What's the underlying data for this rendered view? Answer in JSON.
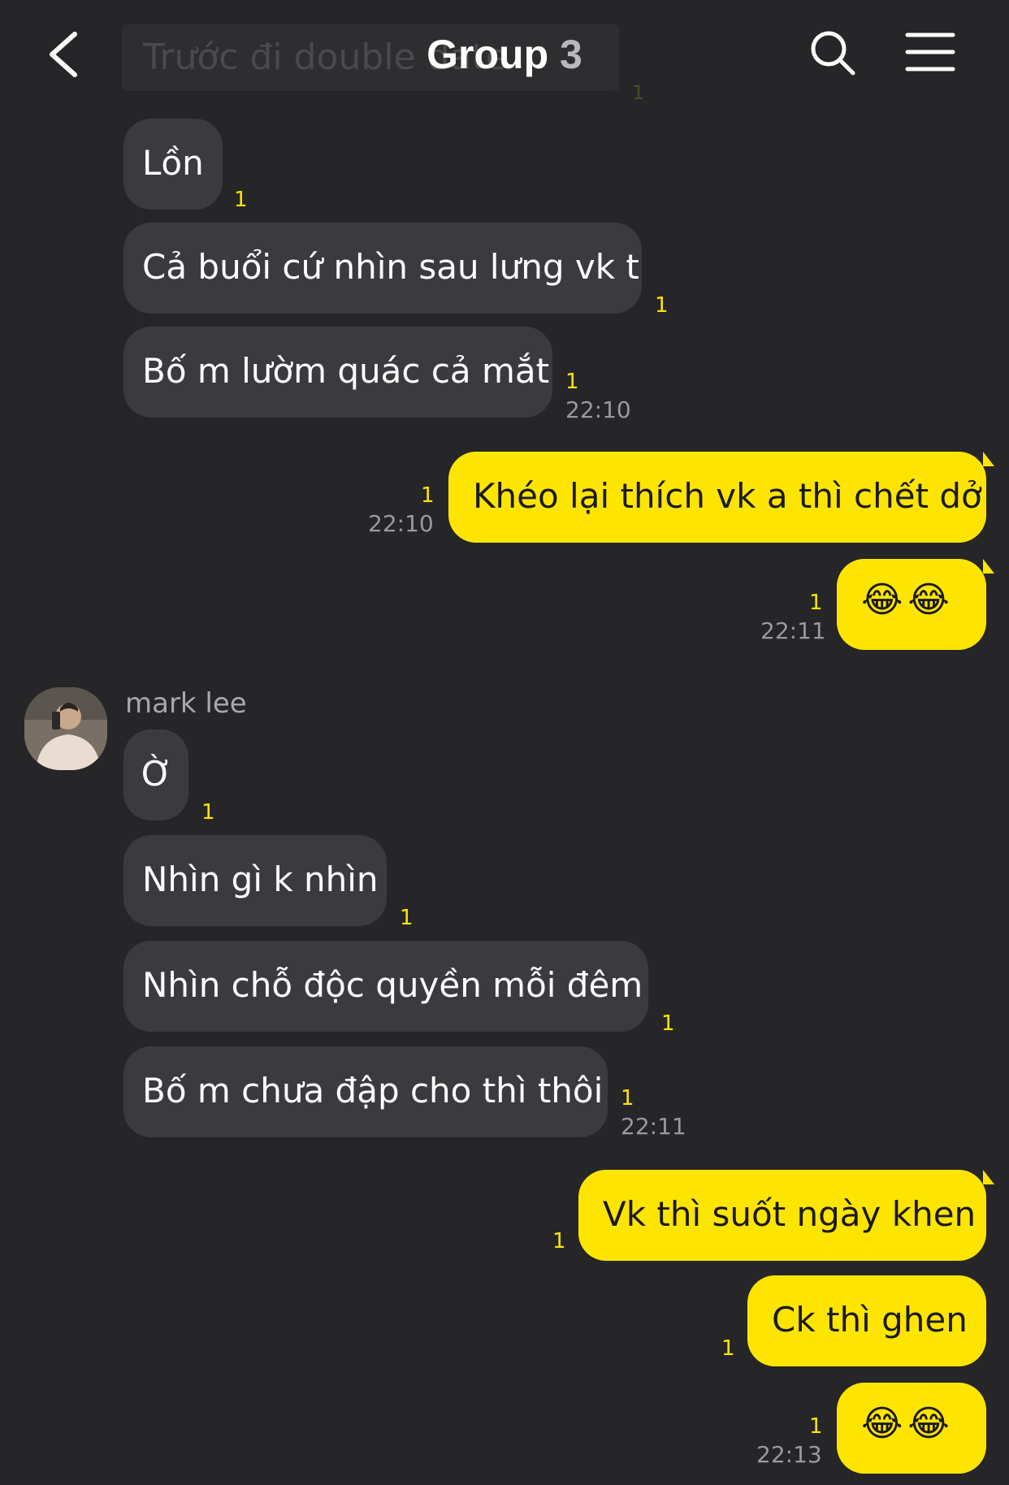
{
  "header": {
    "title": "Group",
    "member_count": "3",
    "ghost_preview_text": "Trước đi double date",
    "ghost_preview_unread": "1"
  },
  "messages": [
    {
      "text": "Lồn",
      "unread": "1"
    },
    {
      "text": "Cả buổi cứ nhìn sau lưng vk t",
      "unread": "1"
    },
    {
      "text": "Bố m lườm quác cả mắt",
      "unread": "1",
      "time": "22:10"
    },
    {
      "text": "Khéo lại thích vk a thì chết dở",
      "unread": "1",
      "time": "22:10"
    },
    {
      "text": "😂😂",
      "unread": "1",
      "time": "22:11"
    },
    {
      "sender": "mark lee",
      "text": "Ờ",
      "unread": "1"
    },
    {
      "text": "Nhìn gì k nhìn",
      "unread": "1"
    },
    {
      "text": "Nhìn chỗ độc quyền mỗi đêm",
      "unread": "1"
    },
    {
      "text": "Bố m chưa đập cho thì thôi",
      "unread": "1",
      "time": "22:11"
    },
    {
      "text": "Vk thì suốt ngày khen",
      "unread": "1"
    },
    {
      "text": "Ck thì ghen",
      "unread": "1"
    },
    {
      "text": "😂😂",
      "unread": "1",
      "time": "22:13"
    }
  ],
  "colors": {
    "background": "#262629",
    "incoming_bubble": "#3b3b3f",
    "outgoing_bubble": "#fee500",
    "unread_count": "#fee500",
    "timestamp": "#9a9a9d"
  },
  "icons": {
    "back": "chevron-left-icon",
    "search": "search-icon",
    "menu": "hamburger-menu-icon"
  }
}
